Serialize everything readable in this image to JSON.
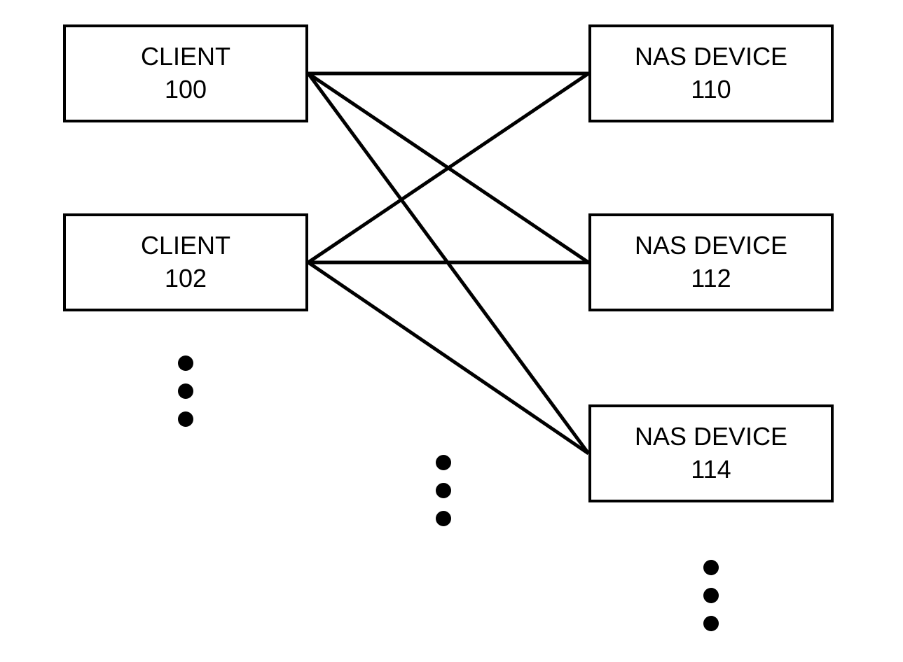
{
  "diagram": {
    "type": "network-topology",
    "description": "Clients connecting to multiple NAS devices in a mesh pattern",
    "nodes": {
      "client100": {
        "title": "CLIENT",
        "id": "100"
      },
      "client102": {
        "title": "CLIENT",
        "id": "102"
      },
      "nas110": {
        "title": "NAS DEVICE",
        "id": "110"
      },
      "nas112": {
        "title": "NAS DEVICE",
        "id": "112"
      },
      "nas114": {
        "title": "NAS DEVICE",
        "id": "114"
      }
    },
    "connections": [
      {
        "from": "client100",
        "to": "nas110"
      },
      {
        "from": "client100",
        "to": "nas112"
      },
      {
        "from": "client100",
        "to": "nas114"
      },
      {
        "from": "client102",
        "to": "nas110"
      },
      {
        "from": "client102",
        "to": "nas112"
      },
      {
        "from": "client102",
        "to": "nas114"
      }
    ]
  }
}
